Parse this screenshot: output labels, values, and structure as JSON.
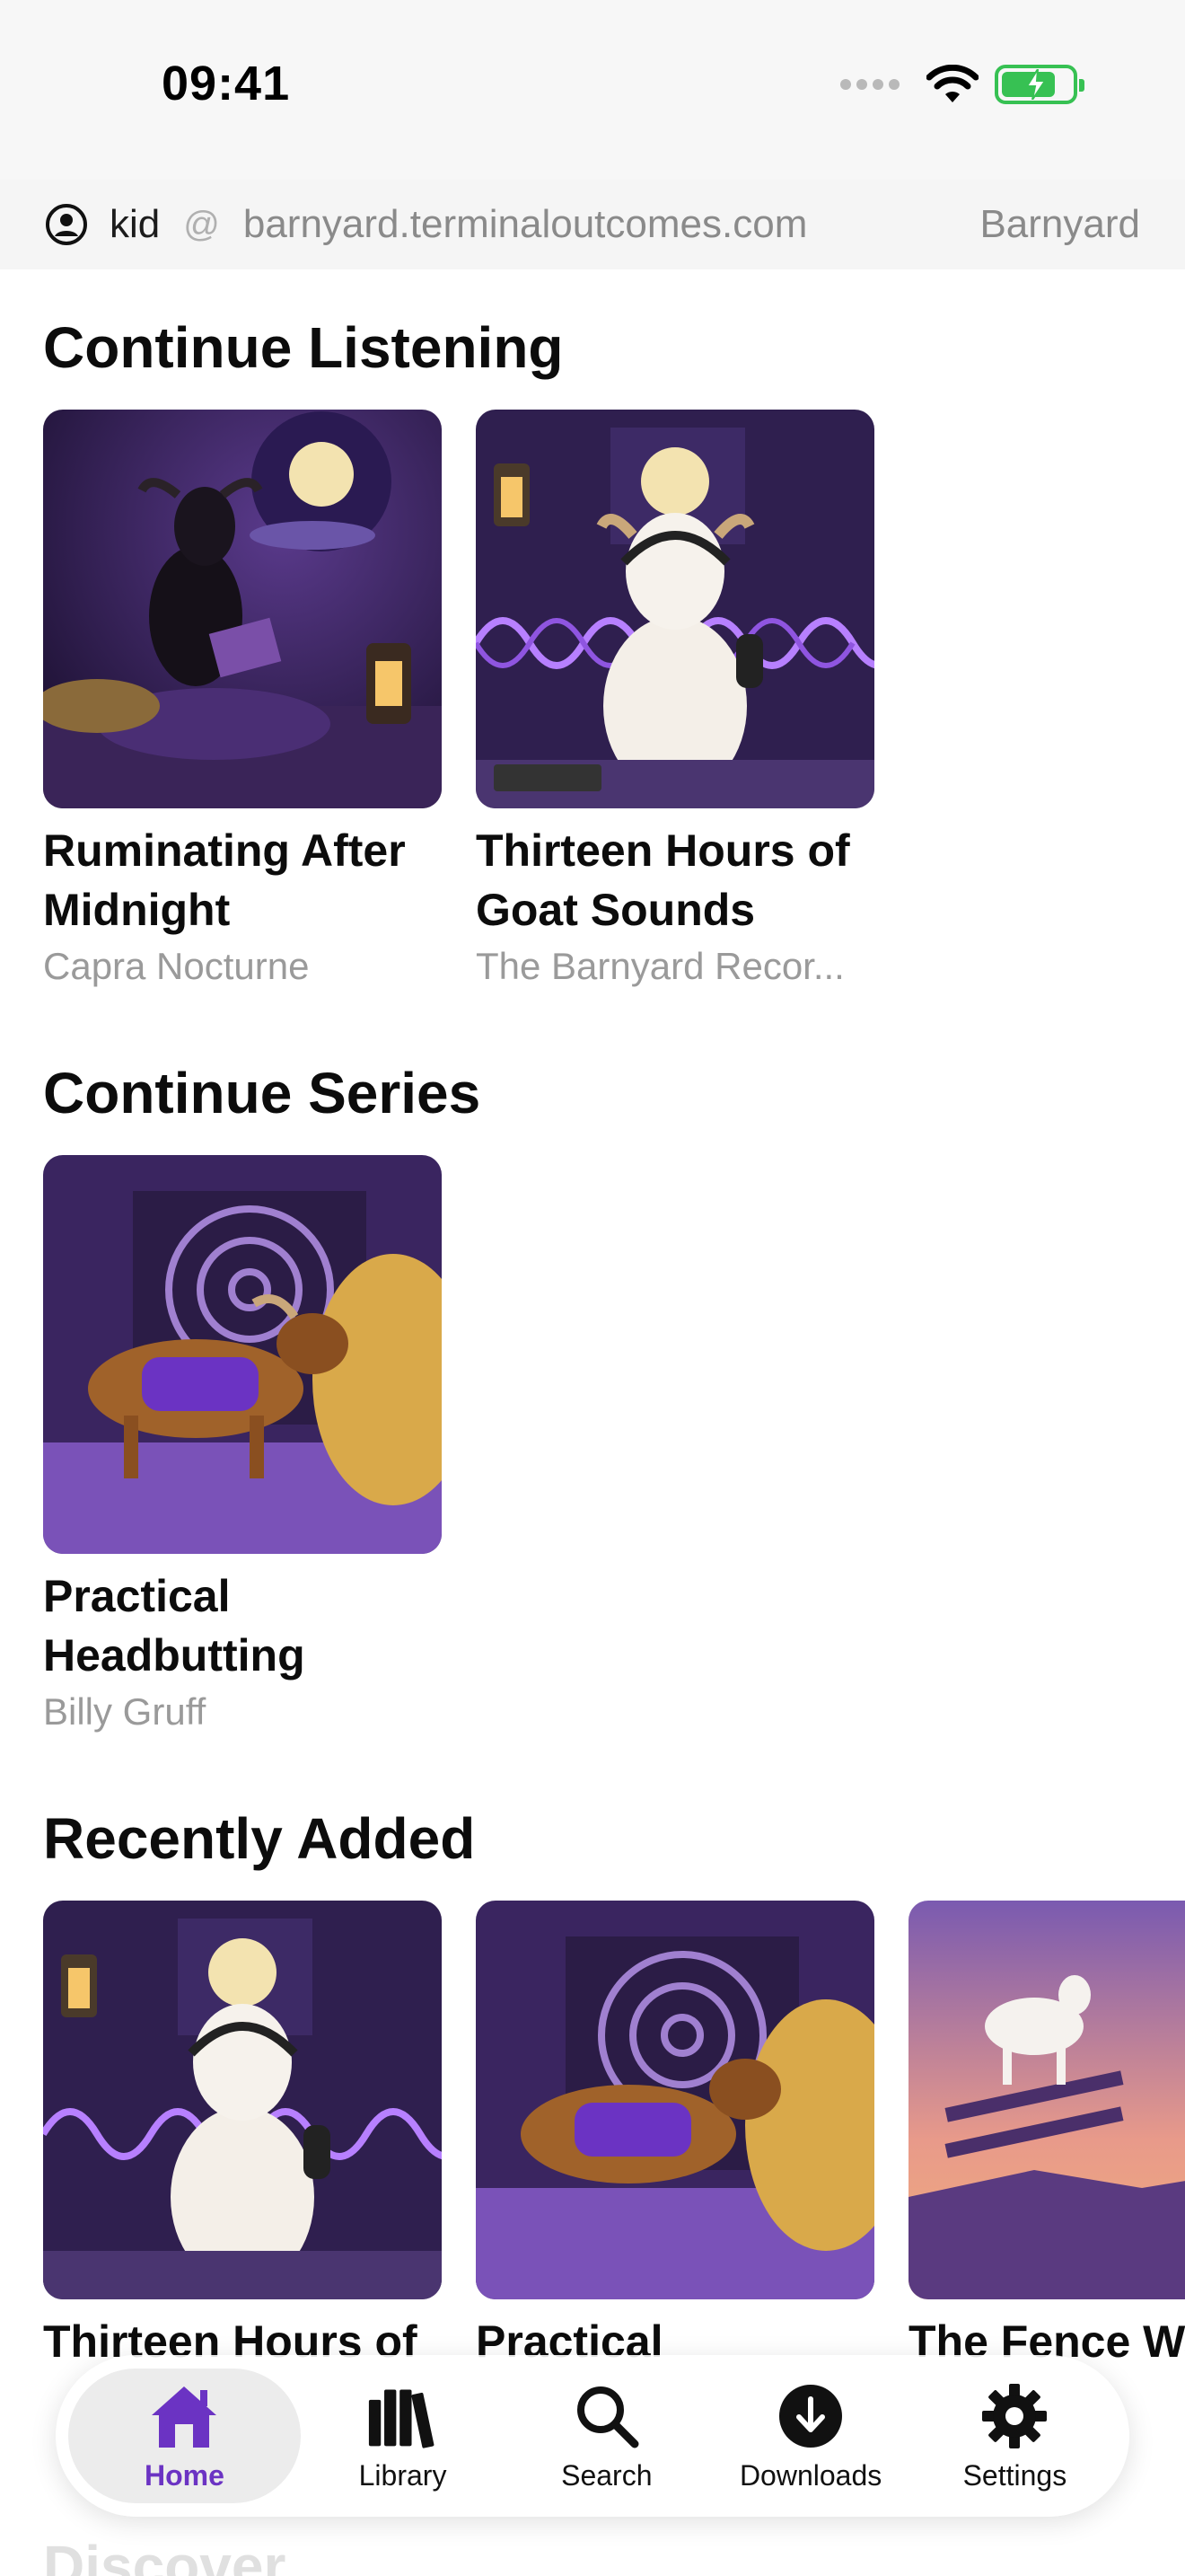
{
  "status": {
    "time": "09:41"
  },
  "server": {
    "user": "kid",
    "at": "@",
    "host": "barnyard.terminaloutcomes.com",
    "library": "Barnyard"
  },
  "sections": {
    "continue_listening": {
      "title": "Continue Listening",
      "items": [
        {
          "title": "Ruminating After Midnight",
          "author": "Capra Nocturne"
        },
        {
          "title": "Thirteen Hours of Goat Sounds",
          "author": "The Barnyard Recor..."
        }
      ]
    },
    "continue_series": {
      "title": "Continue Series",
      "items": [
        {
          "title": "Practical Headbutting",
          "author": "Billy Gruff"
        }
      ]
    },
    "recently_added": {
      "title": "Recently Added",
      "items": [
        {
          "title": "Thirteen Hours of",
          "author": ""
        },
        {
          "title": "Practical",
          "author": ""
        },
        {
          "title": "The Fence Wa",
          "author": ""
        }
      ]
    },
    "discover": {
      "title": "Discover"
    }
  },
  "tabs": [
    {
      "label": "Home",
      "icon": "home-icon",
      "active": true
    },
    {
      "label": "Library",
      "icon": "library-icon",
      "active": false
    },
    {
      "label": "Search",
      "icon": "search-icon",
      "active": false
    },
    {
      "label": "Downloads",
      "icon": "download-icon",
      "active": false
    },
    {
      "label": "Settings",
      "icon": "gear-icon",
      "active": false
    }
  ],
  "colors": {
    "accent": "#6b33c3",
    "battery": "#37c153"
  }
}
